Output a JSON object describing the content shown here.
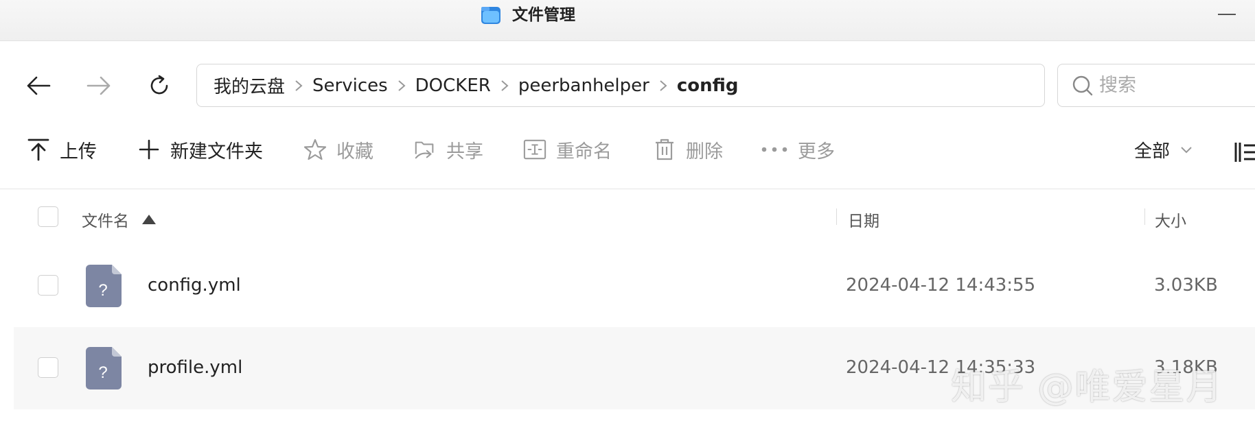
{
  "window": {
    "title": "文件管理",
    "icon": "folder-app-icon",
    "accent": "#3a8ee6"
  },
  "nav": {
    "back": "arrow-left-icon",
    "forward": "arrow-right-icon",
    "refresh": "refresh-icon"
  },
  "breadcrumb": {
    "items": [
      "我的云盘",
      "Services",
      "DOCKER",
      "peerbanhelper",
      "config"
    ]
  },
  "search": {
    "placeholder": "搜索"
  },
  "toolbar": {
    "upload": "上传",
    "new_folder": "新建文件夹",
    "favorite": "收藏",
    "share": "共享",
    "rename": "重命名",
    "delete": "删除",
    "more": "更多"
  },
  "filter": {
    "selected": "全部"
  },
  "table": {
    "columns": {
      "name": "文件名",
      "date": "日期",
      "size": "大小"
    },
    "sort": "ascending",
    "rows": [
      {
        "name": "config.yml",
        "date": "2024-04-12 14:43:55",
        "size": "3.03KB",
        "icon": "unknown-file-icon"
      },
      {
        "name": "profile.yml",
        "date": "2024-04-12 14:35:33",
        "size": "3.18KB",
        "icon": "unknown-file-icon"
      }
    ]
  },
  "watermark": "知乎 @唯爱星月",
  "colors": {
    "file_icon": "#7d86a3",
    "disabled_text": "#9b9b9b"
  }
}
